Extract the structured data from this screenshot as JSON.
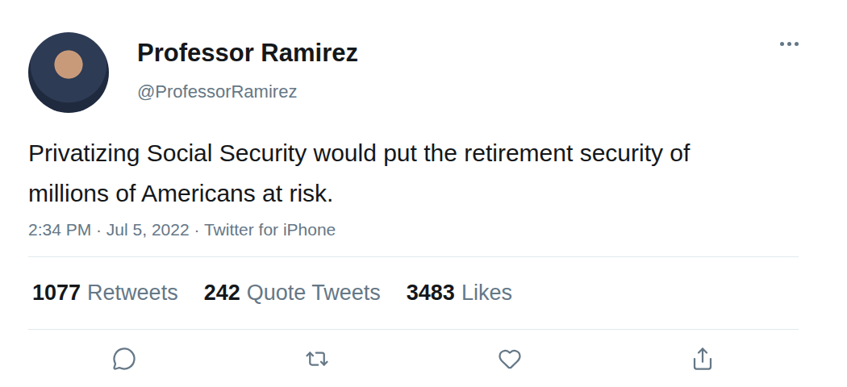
{
  "tweet": {
    "author": {
      "name": "Professor Ramirez",
      "handle": "@ProfessorRamirez"
    },
    "text": "Privatizing Social Security would put the retirement security of millions of Americans at risk.",
    "timestamp": "2:34 PM · Jul 5, 2022 · Twitter for iPhone",
    "stats": [
      {
        "count": "1077",
        "label": "Retweets"
      },
      {
        "count": "242",
        "label": "Quote Tweets"
      },
      {
        "count": "3483",
        "label": "Likes"
      }
    ]
  }
}
